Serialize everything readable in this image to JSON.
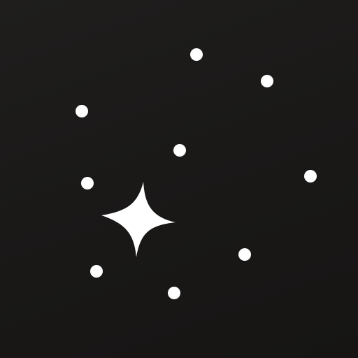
{
  "colors": {
    "background": "#1a1918",
    "star": "#ffffff"
  },
  "icons": {
    "main": "sparkle-icon",
    "points": "dot-icon"
  }
}
